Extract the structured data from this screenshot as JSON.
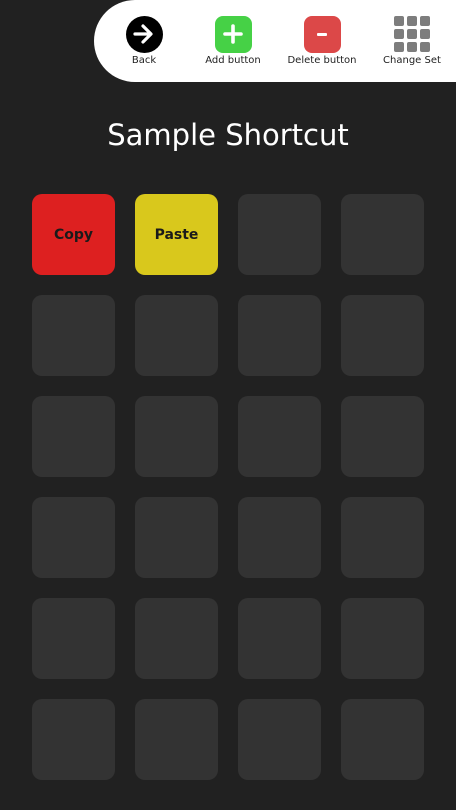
{
  "toolbar": {
    "back_label": "Back",
    "add_label": "Add button",
    "delete_label": "Delete button",
    "delete_symbol": "-",
    "change_set_label": "Change Set"
  },
  "colors": {
    "background": "#212121",
    "toolbar_bg": "#ffffff",
    "add_green": "#46d146",
    "delete_red": "#dc4848",
    "empty_cell": "#333333"
  },
  "title": "Sample Shortcut",
  "grid": {
    "columns": 4,
    "rows": 6,
    "buttons": [
      {
        "label": "Copy",
        "color": "#dd2020"
      },
      {
        "label": "Paste",
        "color": "#d9c81c"
      },
      {
        "label": "",
        "color": "#333333"
      },
      {
        "label": "",
        "color": "#333333"
      },
      {
        "label": "",
        "color": "#333333"
      },
      {
        "label": "",
        "color": "#333333"
      },
      {
        "label": "",
        "color": "#333333"
      },
      {
        "label": "",
        "color": "#333333"
      },
      {
        "label": "",
        "color": "#333333"
      },
      {
        "label": "",
        "color": "#333333"
      },
      {
        "label": "",
        "color": "#333333"
      },
      {
        "label": "",
        "color": "#333333"
      },
      {
        "label": "",
        "color": "#333333"
      },
      {
        "label": "",
        "color": "#333333"
      },
      {
        "label": "",
        "color": "#333333"
      },
      {
        "label": "",
        "color": "#333333"
      },
      {
        "label": "",
        "color": "#333333"
      },
      {
        "label": "",
        "color": "#333333"
      },
      {
        "label": "",
        "color": "#333333"
      },
      {
        "label": "",
        "color": "#333333"
      },
      {
        "label": "",
        "color": "#333333"
      },
      {
        "label": "",
        "color": "#333333"
      },
      {
        "label": "",
        "color": "#333333"
      },
      {
        "label": "",
        "color": "#333333"
      }
    ]
  }
}
